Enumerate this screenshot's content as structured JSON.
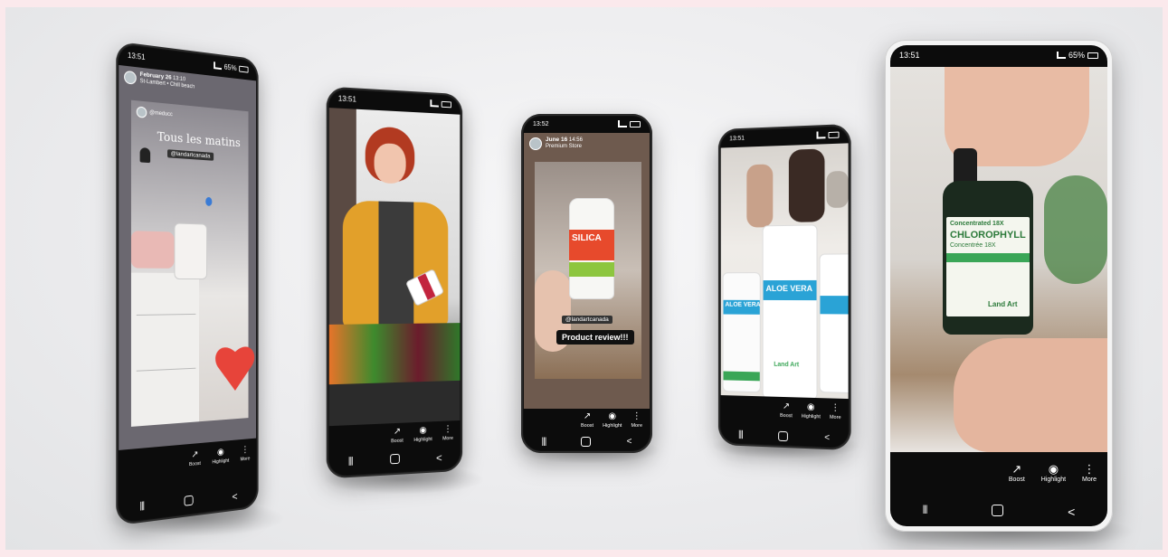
{
  "colors": {
    "screen_bg": "#0c0c0c",
    "accent_green": "#3aa657",
    "heart_red": "#e7443a",
    "cardigan_yellow": "#e2a02a"
  },
  "common": {
    "actions": [
      {
        "icon": "trending-up-icon",
        "label": "Boost"
      },
      {
        "icon": "highlight-icon",
        "label": "Highlight"
      },
      {
        "icon": "more-vertical-icon",
        "label": "More"
      }
    ],
    "nav": {
      "recents": "|||",
      "home": "",
      "back": "<"
    }
  },
  "phones": [
    {
      "time": "13:51",
      "battery": "65%",
      "header": {
        "date": "February 26",
        "time": "13:10",
        "subtitle": "St-Lambert • Chill beach"
      },
      "mention": "@meducc",
      "caption": "Tous les matins",
      "tag": "@landartcanada"
    },
    {
      "time": "13:51"
    },
    {
      "time": "13:52",
      "header": {
        "date": "June 16",
        "time": "14:56",
        "subtitle": "Premium Store"
      },
      "product": "SILICA",
      "tag": "@landartcanada",
      "caption": "Product review!!!"
    },
    {
      "time": "13:51",
      "product": "ALOE VERA",
      "product_brand": "Land Art"
    },
    {
      "time": "13:51",
      "battery": "65%",
      "product_top": "Concentrated 18X",
      "product": "CHLOROPHYLL",
      "product_sub": "Concentrée 18X",
      "product_brand": "Land Art"
    }
  ]
}
